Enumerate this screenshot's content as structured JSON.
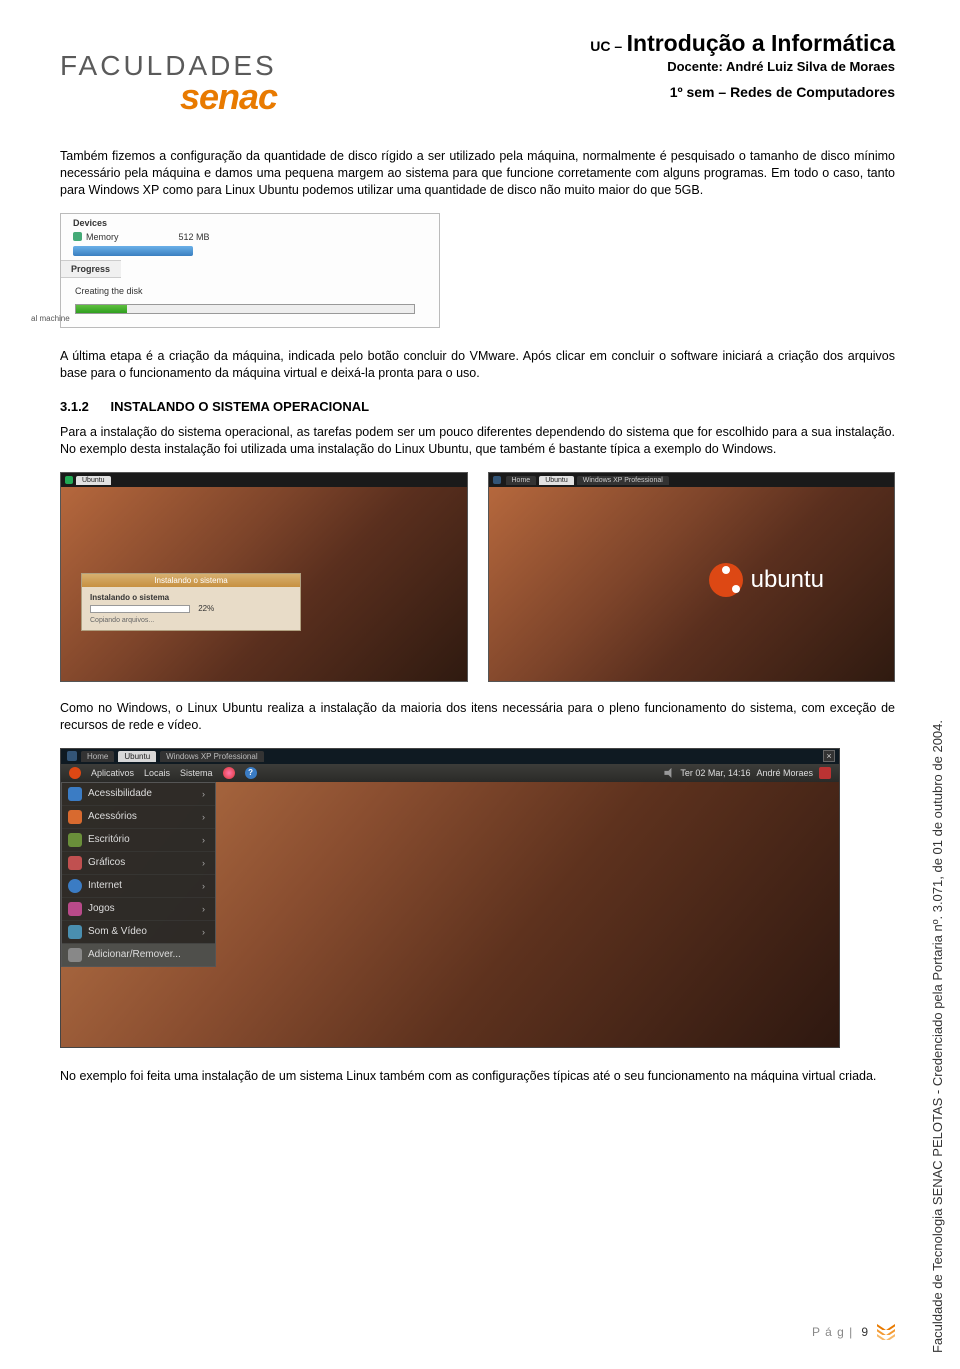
{
  "header": {
    "logo_top": "FACULDADES",
    "logo_bottom": "senac",
    "uc_prefix": "UC –",
    "uc_title": "Introdução a Informática",
    "docente": "Docente: André Luiz Silva de Moraes",
    "subhead": "1º sem – Redes de Computadores"
  },
  "p1": "Também fizemos a configuração da quantidade de disco rígido a ser utilizado pela máquina, normalmente é pesquisado o tamanho de disco mínimo necessário pela máquina e damos uma pequena margem ao sistema para que funcione corretamente com alguns programas. Em todo o caso, tanto para Windows XP como para Linux Ubuntu podemos utilizar uma quantidade de disco não muito maior do que 5GB.",
  "fig1": {
    "devices": "Devices",
    "memory_label": "Memory",
    "memory_value": "512 MB",
    "progress_label": "Progress",
    "creating": "Creating the disk",
    "al_machine": "al machine"
  },
  "p2": "A última etapa é a criação da máquina, indicada pelo botão concluir do VMware. Após clicar em concluir o software iniciará a criação dos arquivos base para o funcionamento da máquina virtual e deixá-la pronta para o uso.",
  "section": {
    "num": "3.1.2",
    "title": "INSTALANDO O SISTEMA OPERACIONAL"
  },
  "p3": "Para a instalação do sistema operacional, as tarefas podem ser um pouco diferentes dependendo do sistema que for escolhido para a sua instalação. No exemplo desta instalação foi utilizada uma instalação do Linux Ubuntu, que também é bastante típica a exemplo do Windows.",
  "shot_left": {
    "tab1": "Ubuntu",
    "dlg_title": "Instalando o sistema",
    "dlg_strong": "Instalando o sistema",
    "dlg_pct": "22%",
    "dlg_sub": "Copiando arquivos..."
  },
  "shot_right": {
    "tab_home": "Home",
    "tab1": "Ubuntu",
    "tab2": "Windows XP Professional",
    "logo_word": "ubuntu"
  },
  "p4": "Como no Windows, o Linux Ubuntu realiza a instalação da maioria dos itens necessária para o pleno funcionamento do sistema, com exceção de recursos de rede e vídeo.",
  "panel": {
    "tab_home": "Home",
    "tab1": "Ubuntu",
    "tab2": "Windows XP Professional",
    "menu": {
      "aplicativos": "Aplicativos",
      "locais": "Locais",
      "sistema": "Sistema",
      "clock": "Ter 02 Mar, 14:16",
      "user": "André Moraes"
    },
    "dropdown": [
      "Acessibilidade",
      "Acessórios",
      "Escritório",
      "Gráficos",
      "Internet",
      "Jogos",
      "Som & Vídeo",
      "Adicionar/Remover..."
    ]
  },
  "p5": "No exemplo foi feita uma instalação de um sistema Linux também com as configurações típicas até o seu funcionamento na máquina virtual criada.",
  "side": "Faculdade de Tecnologia SENAC PELOTAS - Credenciado pela Portaria nº. 3.071, de 01 de outubro de 2004.",
  "footer": {
    "label": "P á g |",
    "num": "9"
  }
}
